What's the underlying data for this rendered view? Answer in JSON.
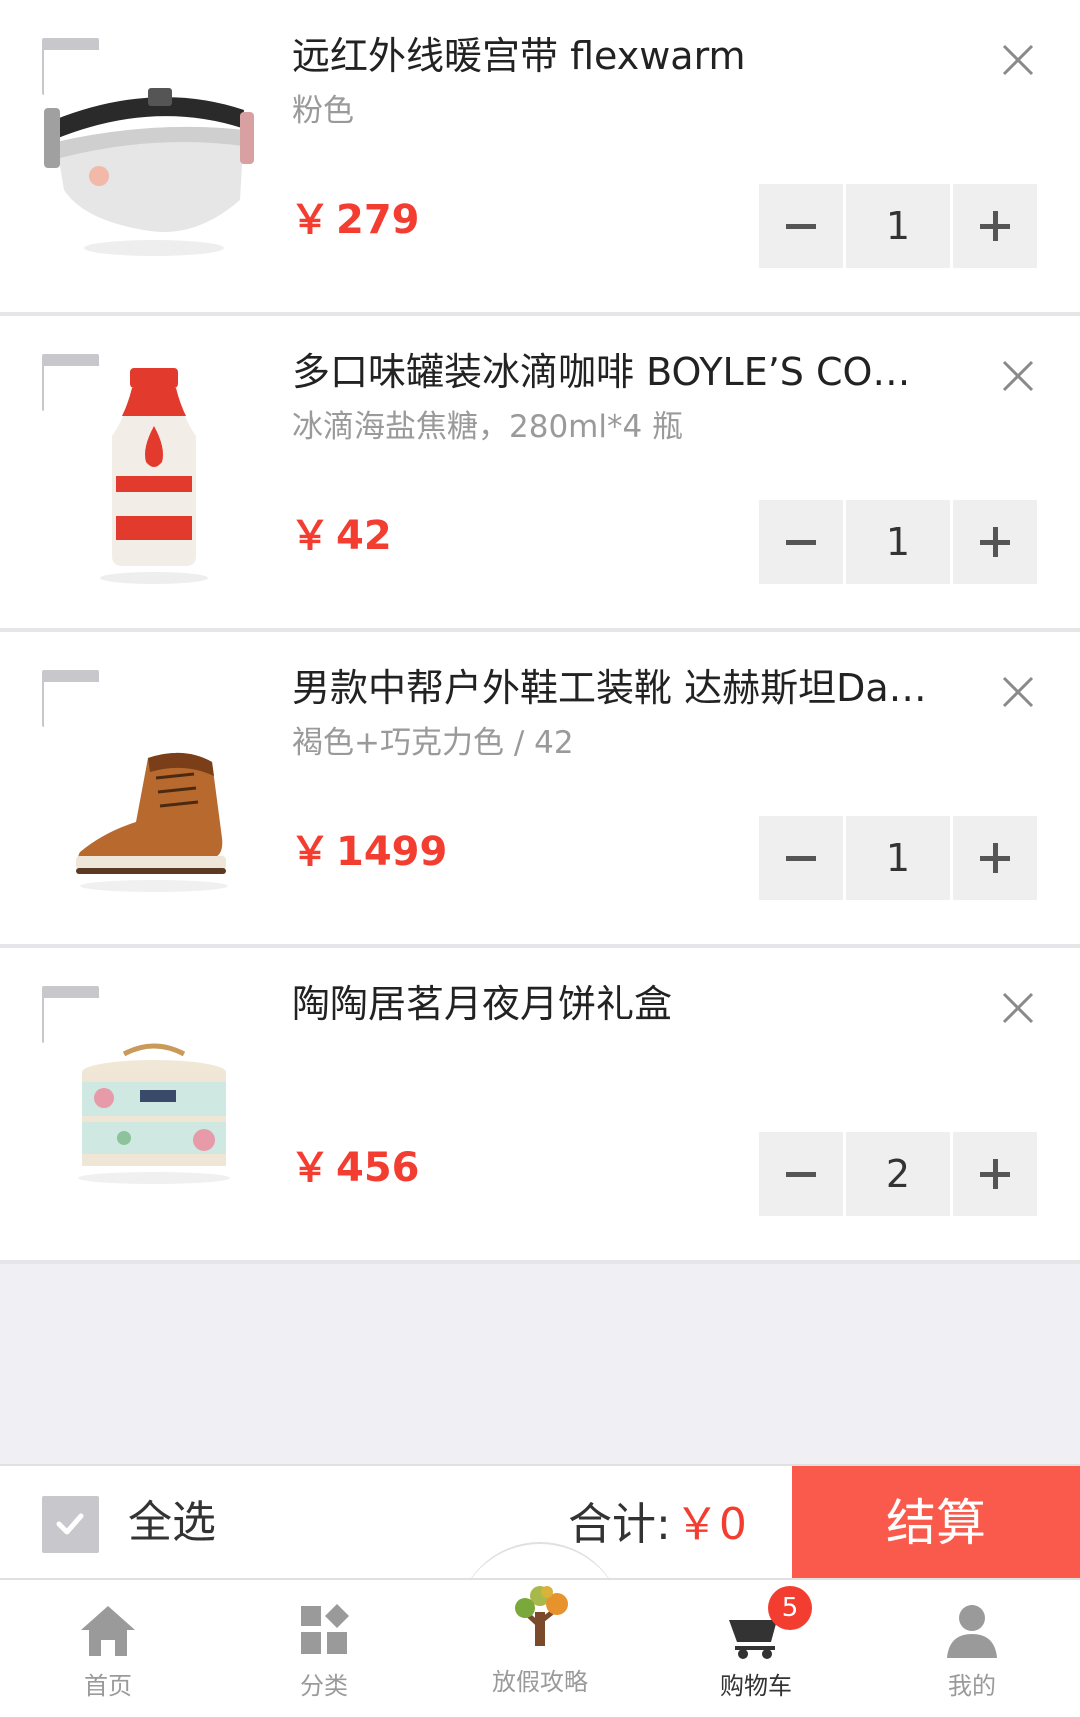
{
  "colors": {
    "accent": "#f23d30",
    "pay_button": "#f95a4c",
    "muted_text": "#9a9a9a"
  },
  "cart": {
    "items": [
      {
        "title": "远红外线暖宫带 flexwarm",
        "spec": "粉色",
        "currency": "￥",
        "price": "279",
        "qty": "1",
        "image": "waist-belt-image"
      },
      {
        "title": "多口味罐装冰滴咖啡 BOYLE’S CO…",
        "spec": "冰滴海盐焦糖，280ml*4 瓶",
        "currency": "￥",
        "price": "42",
        "qty": "1",
        "image": "coffee-bottle-image"
      },
      {
        "title": "男款中帮户外鞋工装靴 达赫斯坦Da…",
        "spec": "褐色+巧克力色 / 42",
        "currency": "￥",
        "price": "1499",
        "qty": "1",
        "image": "boot-image"
      },
      {
        "title": "陶陶居茗月夜月饼礼盒",
        "spec": "",
        "currency": "￥",
        "price": "456",
        "qty": "2",
        "image": "mooncake-box-image"
      }
    ]
  },
  "checkout": {
    "select_all_label": "全选",
    "total_label": "合计:",
    "total_value": "￥0",
    "pay_label": "结算"
  },
  "tabbar": {
    "tabs": [
      {
        "label": "首页",
        "icon": "home-icon"
      },
      {
        "label": "分类",
        "icon": "category-grid-icon"
      },
      {
        "label": "放假攻略",
        "icon": "tree-icon"
      },
      {
        "label": "购物车",
        "icon": "cart-icon",
        "badge": "5"
      },
      {
        "label": "我的",
        "icon": "user-icon"
      }
    ]
  }
}
